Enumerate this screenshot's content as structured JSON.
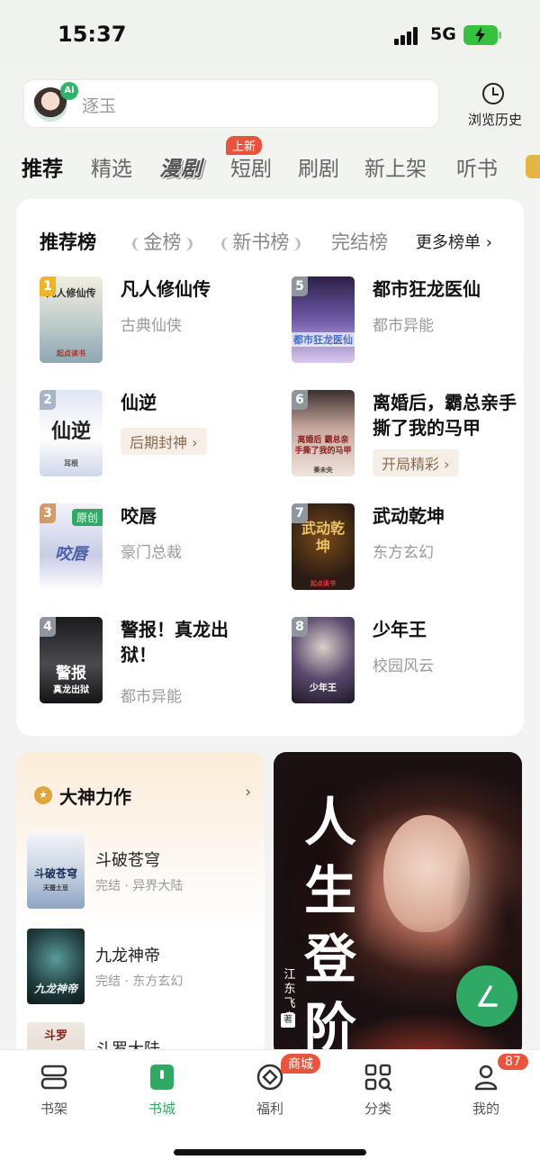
{
  "status_bar": {
    "time": "15:37",
    "network": "5G"
  },
  "search": {
    "placeholder": "逐玉",
    "ai_badge": "Ai",
    "history_label": "浏览历史"
  },
  "tabs": [
    {
      "label": "推荐",
      "active": true
    },
    {
      "label": "精选"
    },
    {
      "label": "漫剧",
      "badge": "上新"
    },
    {
      "label": "短剧"
    },
    {
      "label": "刷剧"
    },
    {
      "label": "新上架"
    },
    {
      "label": "听书"
    }
  ],
  "ranking": {
    "tabs": [
      "推荐榜",
      "金榜",
      "新书榜",
      "完结榜"
    ],
    "more": "更多榜单",
    "items": [
      {
        "rank": "1",
        "title": "凡人修仙传",
        "sub": "古典仙侠",
        "cover_text": "凡人修仙传",
        "cover_publisher": "起点读书",
        "cover_color": "#b9c7c9",
        "num_color": "#f0b429"
      },
      {
        "rank": "5",
        "title": "都市狂龙医仙",
        "sub": "都市异能",
        "cover_text": "都市狂龙医仙",
        "cover_color": "#5a4f8f",
        "num_color": "#9aa0a6"
      },
      {
        "rank": "2",
        "title": "仙逆",
        "tag": "后期封神",
        "cover_text": "仙逆",
        "cover_author": "耳根",
        "cover_color": "#e3e8f0",
        "num_color": "#a9b4c8"
      },
      {
        "rank": "6",
        "title": "离婚后，霸总亲手撕了我的马甲",
        "tag": "开局精彩",
        "cover_text": "离婚后 霸总亲手撕了我的马甲",
        "cover_author": "秦未央",
        "cover_color": "#d8c8c0",
        "num_color": "#9aa0a6"
      },
      {
        "rank": "3",
        "title": "咬唇",
        "sub": "豪门总裁",
        "cover_text": "咬唇",
        "cover_badge": "原创",
        "cover_color": "#e9ecf4",
        "num_color": "#d39a6a"
      },
      {
        "rank": "7",
        "title": "武动乾坤",
        "sub": "东方玄幻",
        "cover_text": "武动乾坤",
        "cover_publisher": "起点读书",
        "cover_color": "#2a1c14",
        "num_color": "#9aa0a6"
      },
      {
        "rank": "4",
        "title": "警报！真龙出狱！",
        "sub": "都市异能",
        "cover_text": "警报",
        "cover_subtext": "真龙出狱",
        "cover_color": "#2b2b2d",
        "num_color": "#9aa0a6"
      },
      {
        "rank": "8",
        "title": "少年王",
        "sub": "校园风云",
        "cover_text": "少年王",
        "cover_color": "#4a3e5a",
        "num_color": "#9aa0a6"
      }
    ]
  },
  "dashen": {
    "title": "大神力作",
    "books": [
      {
        "title": "斗破苍穹",
        "sub": "完结 · 异界大陆",
        "cover_text": "斗破苍穹",
        "cover_author": "天蚕土豆",
        "cover_color": "#dfe4ea"
      },
      {
        "title": "九龙神帝",
        "sub": "完结 · 东方玄幻",
        "cover_text": "九龙神帝",
        "cover_color": "#1f3a3a"
      },
      {
        "title": "斗罗大陆",
        "sub": "",
        "cover_text": "斗罗",
        "cover_color": "#e8e4e0"
      }
    ]
  },
  "promo": {
    "title": "人生登阶",
    "author": "江东飞鸟",
    "author_mark": "著"
  },
  "bottom_nav": [
    {
      "label": "书架"
    },
    {
      "label": "书城",
      "active": true
    },
    {
      "label": "福利",
      "badge": "商城"
    },
    {
      "label": "分类"
    },
    {
      "label": "我的",
      "badge": "87"
    }
  ],
  "colors": {
    "accent": "#2fa964",
    "badge": "#e8553c"
  }
}
